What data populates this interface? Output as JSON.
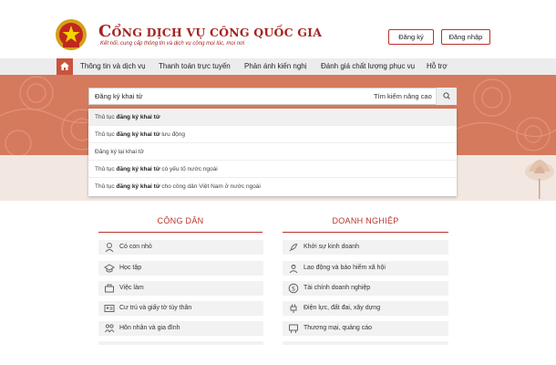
{
  "header": {
    "title_first_letter": "C",
    "title_rest": "ỔNG DỊCH VỤ CÔNG QUỐC GIA",
    "subtitle": "Kết nối, cung cấp thông tin và dịch vụ công mọi lúc, mọi nơi",
    "register_label": "Đăng ký",
    "login_label": "Đăng nhập"
  },
  "nav": {
    "home_icon": "home-icon",
    "items": [
      {
        "label": "Thông tin và dịch vụ"
      },
      {
        "label": "Thanh toán trực tuyến"
      },
      {
        "label": "Phản ánh kiến nghị"
      },
      {
        "label": "Đánh giá chất lượng phục vụ"
      },
      {
        "label": "Hỗ trợ"
      }
    ]
  },
  "search": {
    "value": "Đăng ký khai tử",
    "advanced_label": "Tìm kiếm nâng cao",
    "icon": "search-icon"
  },
  "suggestions": [
    {
      "prefix": "Thủ tục ",
      "bold": "đăng ký khai tử",
      "suffix": ""
    },
    {
      "prefix": "Thủ tục ",
      "bold": "đăng ký khai tử",
      "suffix": " lưu động"
    },
    {
      "prefix": "Đăng ký lại khai tử",
      "bold": "",
      "suffix": ""
    },
    {
      "prefix": "Thủ tục ",
      "bold": "đăng ký khai tử",
      "suffix": " có yếu tố nước ngoài"
    },
    {
      "prefix": "Thủ tục ",
      "bold": "đăng ký khai tử",
      "suffix": " cho công dân Việt Nam ở nước ngoài"
    }
  ],
  "citizen": {
    "title": "CÔNG DÂN",
    "items": [
      {
        "label": "Có con nhỏ",
        "icon": "baby-icon"
      },
      {
        "label": "Học tập",
        "icon": "graduation-cap-icon"
      },
      {
        "label": "Việc làm",
        "icon": "briefcase-icon"
      },
      {
        "label": "Cư trú và giấy tờ tùy thân",
        "icon": "id-card-icon"
      },
      {
        "label": "Hôn nhân và gia đình",
        "icon": "family-icon"
      }
    ]
  },
  "business": {
    "title": "DOANH NGHIỆP",
    "items": [
      {
        "label": "Khởi sự kinh doanh",
        "icon": "rocket-icon"
      },
      {
        "label": "Lao động và bảo hiểm xã hội",
        "icon": "worker-icon"
      },
      {
        "label": "Tài chính doanh nghiệp",
        "icon": "dollar-icon"
      },
      {
        "label": "Điện lực, đất đai, xây dựng",
        "icon": "plug-icon"
      },
      {
        "label": "Thương mại, quảng cáo",
        "icon": "billboard-icon"
      }
    ]
  },
  "colors": {
    "brand": "#b7332c",
    "hero": "#d67a5d"
  }
}
